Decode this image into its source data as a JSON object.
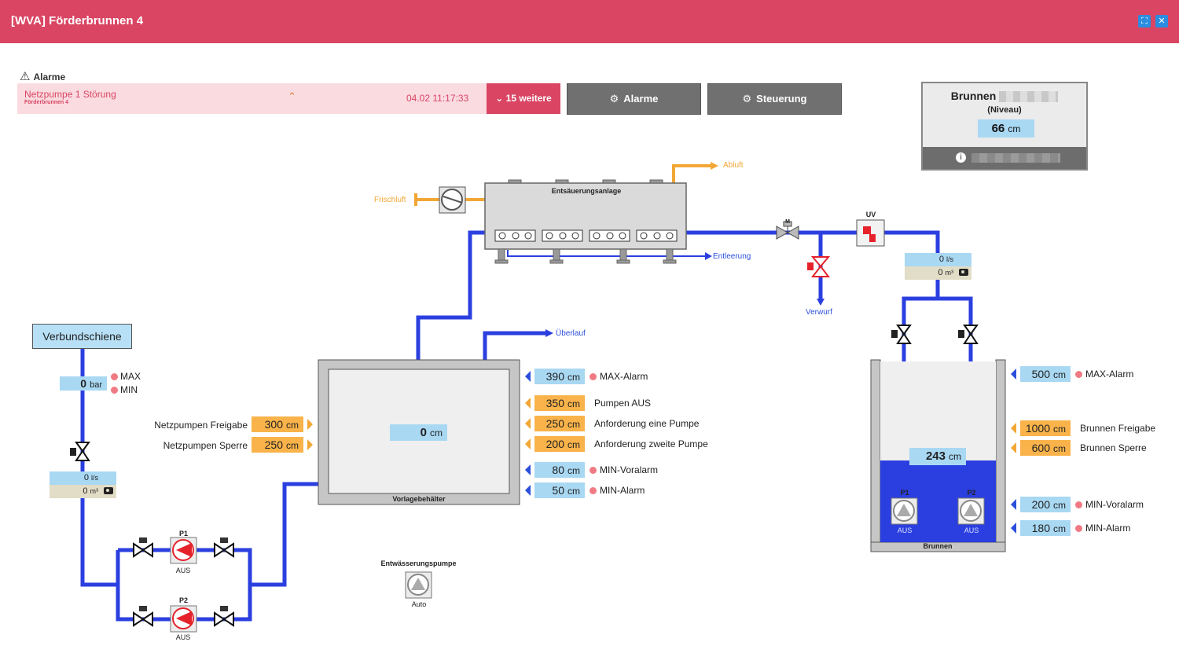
{
  "window": {
    "title": "[WVA] Förderbrunnen 4",
    "fullscreen_icon": "expand-icon",
    "close_icon": "close-icon"
  },
  "alarms": {
    "header": "Alarme",
    "current": {
      "text": "Netzpumpe 1 Störung",
      "source": "Förderbrunnen 4",
      "time": "04.02 11:17:33"
    },
    "more_label": "15 weitere",
    "alarme_button": "Alarme",
    "steuerung_button": "Steuerung"
  },
  "well_panel": {
    "title": "Brunnen",
    "subtitle": "(Niveau)",
    "value": "66",
    "unit": "cm"
  },
  "colors": {
    "pipe_water": "#2b3fe0",
    "pipe_air": "#f2a735",
    "header": "#d94563",
    "value_blue": "#a9d8f3",
    "value_orange": "#f9b34a",
    "alarm_dot": "#f07a84"
  },
  "diagram": {
    "entsaeuerung": "Entsäuerungsanlage",
    "frischluft": "Frischluft",
    "abluft": "Abluft",
    "entleerung": "Entleerung",
    "verwurf": "Verwurf",
    "ueberlauf": "Überlauf",
    "uv": "UV",
    "valve_m": "M",
    "vorlage": {
      "name": "Vorlagebehälter",
      "value": "0",
      "unit": "cm"
    },
    "verbundschiene": "Verbundschiene",
    "pressure": {
      "value": "0",
      "unit": "bar",
      "max": "MAX",
      "min": "MIN"
    },
    "flow_left": {
      "rate": "0",
      "rate_unit": "l/s",
      "volume": "0",
      "volume_unit": "m³"
    },
    "flow_right": {
      "rate": "0",
      "rate_unit": "l/s",
      "volume": "0",
      "volume_unit": "m³"
    },
    "netzpumpen": [
      {
        "label": "Netzpumpen Freigabe",
        "value": "300",
        "unit": "cm"
      },
      {
        "label": "Netzpumpen Sperre",
        "value": "250",
        "unit": "cm"
      }
    ],
    "vorlage_levels": [
      {
        "value": "390",
        "unit": "cm",
        "label": "MAX-Alarm",
        "kind": "blue"
      },
      {
        "value": "350",
        "unit": "cm",
        "label": "Pumpen AUS",
        "kind": "orange"
      },
      {
        "value": "250",
        "unit": "cm",
        "label": "Anforderung eine Pumpe",
        "kind": "orange"
      },
      {
        "value": "200",
        "unit": "cm",
        "label": "Anforderung zweite Pumpe",
        "kind": "orange"
      },
      {
        "value": "80",
        "unit": "cm",
        "label": "MIN-Voralarm",
        "kind": "blue"
      },
      {
        "value": "50",
        "unit": "cm",
        "label": "MIN-Alarm",
        "kind": "blue"
      }
    ],
    "brunnen": {
      "name": "Brunnen",
      "level": "243",
      "unit": "cm",
      "fill_fraction": 0.45
    },
    "brunnen_levels": [
      {
        "value": "500",
        "unit": "cm",
        "label": "MAX-Alarm",
        "kind": "blue"
      },
      {
        "value": "1000",
        "unit": "cm",
        "label": "Brunnen Freigabe",
        "kind": "orange"
      },
      {
        "value": "600",
        "unit": "cm",
        "label": "Brunnen Sperre",
        "kind": "orange"
      },
      {
        "value": "200",
        "unit": "cm",
        "label": "MIN-Voralarm",
        "kind": "blue"
      },
      {
        "value": "180",
        "unit": "cm",
        "label": "MIN-Alarm",
        "kind": "blue"
      }
    ],
    "pumps": {
      "net_p1": {
        "name": "P1",
        "state": "AUS"
      },
      "net_p2": {
        "name": "P2",
        "state": "AUS"
      },
      "well_p1": {
        "name": "P1",
        "state": "AUS"
      },
      "well_p2": {
        "name": "P2",
        "state": "AUS"
      },
      "drain": {
        "name": "Entwässerungspumpe",
        "state": "Auto"
      }
    },
    "valve_icon": "valve-icon",
    "pump_icon": "pump-icon",
    "fan_icon": "fan-icon",
    "camera_icon": "camera-icon"
  }
}
